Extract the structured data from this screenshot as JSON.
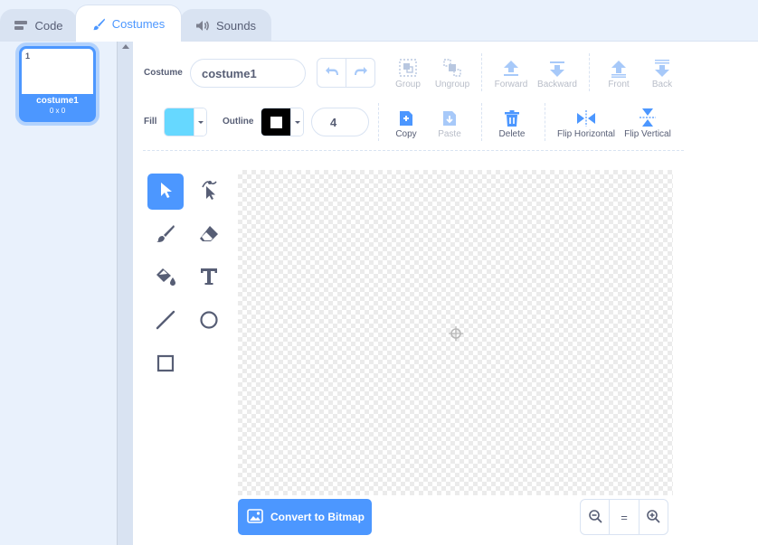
{
  "tabs": [
    {
      "label": "Code",
      "icon": "code-icon"
    },
    {
      "label": "Costumes",
      "icon": "brush-icon"
    },
    {
      "label": "Sounds",
      "icon": "speaker-icon"
    }
  ],
  "costume_list": [
    {
      "number": "1",
      "name": "costume1",
      "size": "0 x 0",
      "selected": true
    }
  ],
  "toolbar": {
    "costume_label": "Costume",
    "costume_name": "costume1",
    "fill_label": "Fill",
    "fill_color": "#66d8ff",
    "outline_label": "Outline",
    "outline_color": "#000000",
    "outline_width": "4",
    "group": "Group",
    "ungroup": "Ungroup",
    "forward": "Forward",
    "backward": "Backward",
    "front": "Front",
    "back": "Back",
    "copy": "Copy",
    "paste": "Paste",
    "delete": "Delete",
    "flip_horizontal": "Flip Horizontal",
    "flip_vertical": "Flip Vertical"
  },
  "tools": [
    "select-icon",
    "reshape-icon",
    "brush-icon",
    "eraser-icon",
    "fill-icon",
    "text-icon",
    "line-icon",
    "circle-icon",
    "rectangle-icon"
  ],
  "canvas": {
    "convert_button": "Convert to Bitmap",
    "zoom_out": "zoom-out-icon",
    "zoom_reset": "=",
    "zoom_in": "zoom-in-icon"
  },
  "colors": {
    "accent": "#4c97ff",
    "text": "#575e75",
    "disabled": "#b8bdc8",
    "panel": "#e9f1fc"
  }
}
